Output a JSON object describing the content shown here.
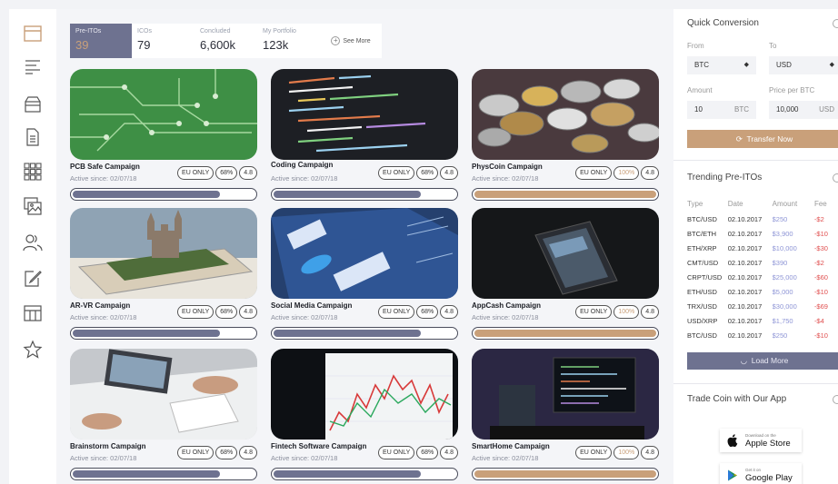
{
  "sidebar": {
    "items": [
      {
        "icon": "window-icon",
        "active": true
      },
      {
        "icon": "menu-lines-icon"
      },
      {
        "icon": "box-icon"
      },
      {
        "icon": "document-icon"
      },
      {
        "icon": "grid-icon"
      },
      {
        "icon": "image-gallery-icon"
      },
      {
        "icon": "users-icon"
      },
      {
        "icon": "edit-icon"
      },
      {
        "icon": "table-icon"
      },
      {
        "icon": "star-icon"
      }
    ]
  },
  "stats": [
    {
      "label": "Pre-ITOs",
      "value": "39",
      "active": true
    },
    {
      "label": "ICOs",
      "value": "79"
    },
    {
      "label": "Concluded",
      "value": "6,600k"
    },
    {
      "label": "My Portfolio",
      "value": "123k"
    }
  ],
  "see_more_label": "See More",
  "campaigns": [
    {
      "title": "PCB Safe Campaign",
      "since": "Active since: 02/07/18",
      "badge": "EU ONLY",
      "percent": "68%",
      "rating": "4.8",
      "progress": 0.81,
      "gold": false
    },
    {
      "title": "Coding Campaign",
      "since": "Active since: 02/07/18",
      "badge": "EU ONLY",
      "percent": "68%",
      "rating": "4.8",
      "progress": 0.81,
      "gold": false
    },
    {
      "title": "PhysCoin Campaign",
      "since": "Active since: 02/07/18",
      "badge": "EU ONLY",
      "percent": "100%",
      "rating": "4.8",
      "progress": 1.0,
      "gold": true
    },
    {
      "title": "AR-VR Campaign",
      "since": "Active since: 02/07/18",
      "badge": "EU ONLY",
      "percent": "68%",
      "rating": "4.8",
      "progress": 0.81,
      "gold": false
    },
    {
      "title": "Social Media Campaign",
      "since": "Active since: 02/07/18",
      "badge": "EU ONLY",
      "percent": "68%",
      "rating": "4.8",
      "progress": 0.81,
      "gold": false
    },
    {
      "title": "AppCash Campaign",
      "since": "Active since: 02/07/18",
      "badge": "EU ONLY",
      "percent": "100%",
      "rating": "4.8",
      "progress": 1.0,
      "gold": true
    },
    {
      "title": "Brainstorm Campaign",
      "since": "Active since: 02/07/18",
      "badge": "EU ONLY",
      "percent": "68%",
      "rating": "4.8",
      "progress": 0.81,
      "gold": false
    },
    {
      "title": "Fintech Software Campaign",
      "since": "Active since: 02/07/18",
      "badge": "EU ONLY",
      "percent": "68%",
      "rating": "4.8",
      "progress": 0.81,
      "gold": false
    },
    {
      "title": "SmartHome Campaign",
      "since": "Active since: 02/07/18",
      "badge": "EU ONLY",
      "percent": "100%",
      "rating": "4.8",
      "progress": 1.0,
      "gold": true
    }
  ],
  "conversion": {
    "title": "Quick Conversion",
    "from_label": "From",
    "to_label": "To",
    "from_value": "BTC",
    "to_value": "USD",
    "amount_label": "Amount",
    "price_label": "Price per BTC",
    "amount_value": "10",
    "amount_unit": "BTC",
    "price_value": "10,000",
    "price_unit": "USD",
    "transfer_label": "Transfer Now"
  },
  "trending": {
    "title": "Trending Pre-ITOs",
    "headers": [
      "Type",
      "Date",
      "Amount",
      "Fee"
    ],
    "rows": [
      [
        "BTC/USD",
        "02.10.2017",
        "$250",
        "-$2"
      ],
      [
        "BTC/ETH",
        "02.10.2017",
        "$3,900",
        "-$10"
      ],
      [
        "ETH/XRP",
        "02.10.2017",
        "$10,000",
        "-$30"
      ],
      [
        "CMT/USD",
        "02.10.2017",
        "$390",
        "-$2"
      ],
      [
        "CRPT/USD",
        "02.10.2017",
        "$25,000",
        "-$60"
      ],
      [
        "ETH/USD",
        "02.10.2017",
        "$5,000",
        "-$10"
      ],
      [
        "TRX/USD",
        "02.10.2017",
        "$30,000",
        "-$69"
      ],
      [
        "USD/XRP",
        "02.10.2017",
        "$1,750",
        "-$4"
      ],
      [
        "BTC/USD",
        "02.10.2017",
        "$250",
        "-$10"
      ]
    ],
    "load_more_label": "Load More"
  },
  "app_section": {
    "title": "Trade Coin with Our App",
    "apple_small": "Download on the",
    "apple_big": "Apple Store",
    "google_small": "Get it on",
    "google_big": "Google Play"
  },
  "colors": {
    "accent": "#6e7290",
    "gold": "#c9a07a",
    "amount": "#8e95d6",
    "fee": "#e05050"
  }
}
